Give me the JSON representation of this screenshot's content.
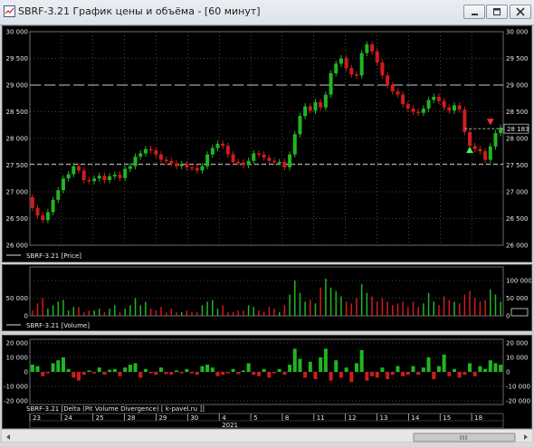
{
  "window": {
    "title": "SBRF-3.21 График цены и объёма - [60 минут]"
  },
  "price_panel": {
    "legend": "SBRF-3.21 [Price]",
    "ticks": [
      "30 000",
      "29 500",
      "29 000",
      "28 500",
      "28 000",
      "27 500",
      "27 000",
      "26 500",
      "26 000"
    ],
    "last_price_label": "28 183",
    "levels": [
      29000,
      27520
    ]
  },
  "volume_panel": {
    "legend": "SBRF-3.21 [Volume]",
    "ticks": [
      "100 000",
      "50 000",
      "0"
    ]
  },
  "delta_panel": {
    "legend": "SBRF-3.21 [Delta (Pit Volume Divergence) [ k-pavel.ru ]]",
    "ticks": [
      "20 000",
      "10 000",
      "0",
      "-10 000",
      "-20 000"
    ]
  },
  "time_axis": {
    "days": [
      "23",
      "24",
      "25",
      "28",
      "29",
      "30",
      "4",
      "5",
      "8",
      "11",
      "12",
      "13",
      "14",
      "15",
      "18"
    ],
    "year": "2021"
  },
  "colors": {
    "up": "#22b522",
    "down": "#d01c1c",
    "grid": "#8a8a8a",
    "marker_up": "#4cf04c",
    "marker_down": "#ff3030"
  },
  "chart_data": {
    "type": "candlestick",
    "interval": "60 минут",
    "series": [
      {
        "name": "SBRF-3.21",
        "values": [
          26700,
          26560,
          26470,
          26620,
          26850,
          27030,
          27250,
          27330,
          27480,
          27400,
          27220,
          27200,
          27250,
          27300,
          27220,
          27290,
          27320,
          27260,
          27430,
          27480,
          27660,
          27720,
          27800,
          27780,
          27700,
          27600,
          27580,
          27530,
          27480,
          27520,
          27460,
          27450,
          27400,
          27480,
          27700,
          27820,
          27900,
          27860,
          27700,
          27560,
          27550,
          27500,
          27580,
          27720,
          27700,
          27640,
          27580,
          27560,
          27560,
          27460,
          27700,
          28080,
          28420,
          28600,
          28520,
          28680,
          28580,
          28820,
          29220,
          29400,
          29500,
          29320,
          29200,
          29180,
          29600,
          29760,
          29630,
          29420,
          29180,
          29000,
          28880,
          28820,
          28640,
          28560,
          28500,
          28480,
          28560,
          28720,
          28780,
          28700,
          28580,
          28520,
          28620,
          28540,
          28120,
          27860,
          27800,
          27760,
          27600,
          27850,
          28100,
          28200
        ]
      }
    ],
    "volume": [
      15000,
      35000,
      50000,
      20000,
      30000,
      40000,
      45000,
      15000,
      25000,
      25000,
      10000,
      15000,
      15000,
      20000,
      10000,
      20000,
      30000,
      10000,
      20000,
      30000,
      50000,
      30000,
      40000,
      20000,
      15000,
      25000,
      10000,
      20000,
      10000,
      10000,
      15000,
      10000,
      10000,
      30000,
      40000,
      45000,
      20000,
      30000,
      10000,
      10000,
      15000,
      15000,
      30000,
      25000,
      15000,
      10000,
      25000,
      20000,
      10000,
      30000,
      60000,
      100000,
      65000,
      40000,
      45000,
      35000,
      80000,
      105000,
      80000,
      70000,
      55000,
      40000,
      35000,
      50000,
      90000,
      65000,
      55000,
      40000,
      50000,
      40000,
      30000,
      35000,
      40000,
      25000,
      40000,
      25000,
      35000,
      65000,
      40000,
      30000,
      55000,
      45000,
      40000,
      35000,
      60000,
      70000,
      50000,
      40000,
      45000,
      75000,
      60000,
      40000
    ],
    "delta": [
      5000,
      4000,
      -3000,
      -1000,
      6000,
      8000,
      10000,
      2000,
      -4000,
      -6000,
      -2000,
      1000,
      -1000,
      3000,
      -2000,
      1500,
      2000,
      -3000,
      3000,
      5000,
      6000,
      -4000,
      2000,
      -1000,
      -2000,
      3000,
      -1500,
      -2000,
      1000,
      -1000,
      2000,
      -1000,
      -2000,
      4000,
      5000,
      3000,
      -3000,
      -2000,
      -1000,
      2000,
      -1500,
      1000,
      6000,
      -2000,
      -3000,
      2000,
      -4000,
      -1000,
      2000,
      -2000,
      5000,
      16000,
      9000,
      -4000,
      7000,
      -5000,
      10000,
      16000,
      -6000,
      8000,
      -4000,
      3000,
      -7000,
      6000,
      15000,
      -6000,
      -3000,
      -4000,
      3000,
      -5000,
      -2000,
      4000,
      -3000,
      -2000,
      4000,
      -2000,
      3000,
      10000,
      -5000,
      4000,
      12000,
      -3000,
      2000,
      -4000,
      -2000,
      6000,
      -3000,
      4000,
      2000,
      8000,
      6000,
      5000
    ],
    "ylim_price": [
      26000,
      30000
    ],
    "ylim_volume": [
      0,
      100000
    ],
    "ylim_delta": [
      -20000,
      20000
    ],
    "grid": true
  }
}
